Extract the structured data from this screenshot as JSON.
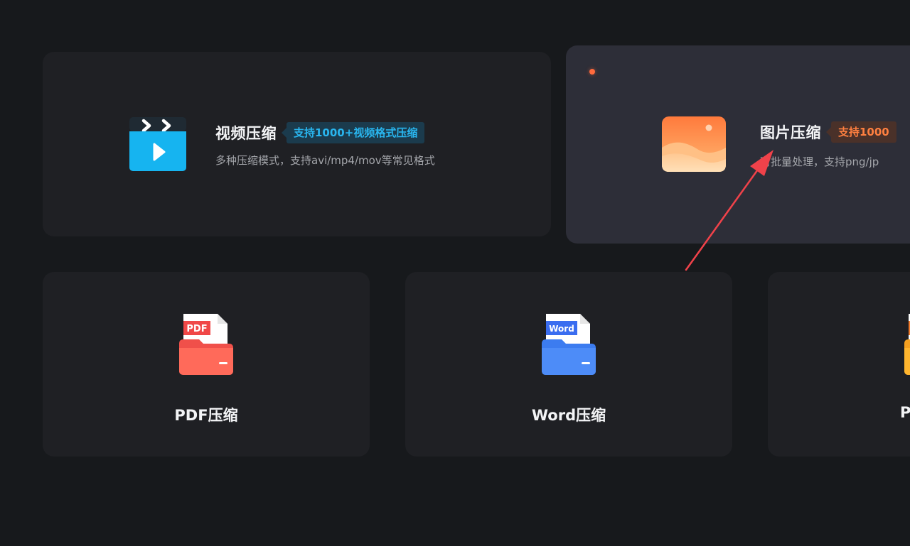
{
  "cards": {
    "video": {
      "title": "视频压缩",
      "tag": "支持1000+视频格式压缩",
      "desc": "多种压缩模式，支持avi/mp4/mov等常见格式",
      "icon": "video-clapper-icon"
    },
    "image": {
      "title": "图片压缩",
      "tag": "支持1000",
      "desc": "可批量处理，支持png/jp",
      "icon": "image-landscape-icon",
      "has_badge_dot": true
    },
    "pdf": {
      "label": "PDF压缩",
      "icon_text": "PDF",
      "icon": "pdf-folder-icon"
    },
    "word": {
      "label": "Word压缩",
      "icon_text": "Word",
      "icon": "word-folder-icon"
    },
    "ppt": {
      "label": "P",
      "icon": "ppt-folder-icon"
    }
  },
  "colors": {
    "background": "#17191c",
    "card": "#1f2024",
    "card_highlight": "#2d2e38",
    "accent_blue": "#29b6ef",
    "accent_orange": "#ff8040",
    "annotation_arrow": "#f0424a"
  },
  "annotation": {
    "type": "red-arrow",
    "points_to": "图片压缩"
  }
}
